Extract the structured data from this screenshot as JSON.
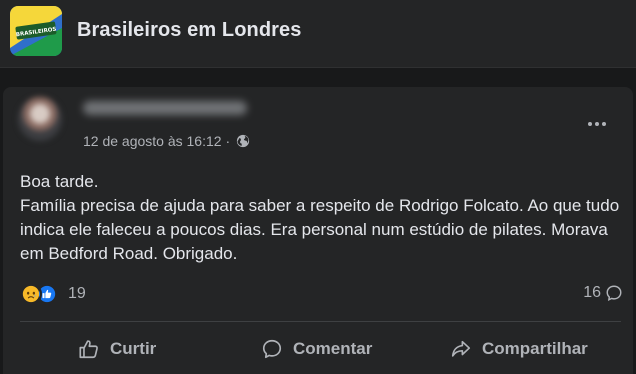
{
  "group": {
    "name": "Brasileiros em Londres",
    "logo_text": "BRASILEIROS"
  },
  "post": {
    "timestamp": "12 de agosto às 16:12 ·",
    "text": "Boa tarde.\nFamília precisa de ajuda para saber a respeito de Rodrigo Folcato. Ao que tudo indica ele faleceu a poucos dias. Era personal num estúdio de pilates. Morava em Bedford Road. Obrigado.",
    "reaction_count": "19",
    "comment_count": "16"
  },
  "actions": {
    "like": "Curtir",
    "comment": "Comentar",
    "share": "Compartilhar"
  },
  "colors": {
    "background": "#18191a",
    "card": "#242526",
    "text_primary": "#e4e6eb",
    "text_secondary": "#b0b3b8",
    "like_blue": "#1877f2",
    "sad_yellow": "#f7b928"
  }
}
